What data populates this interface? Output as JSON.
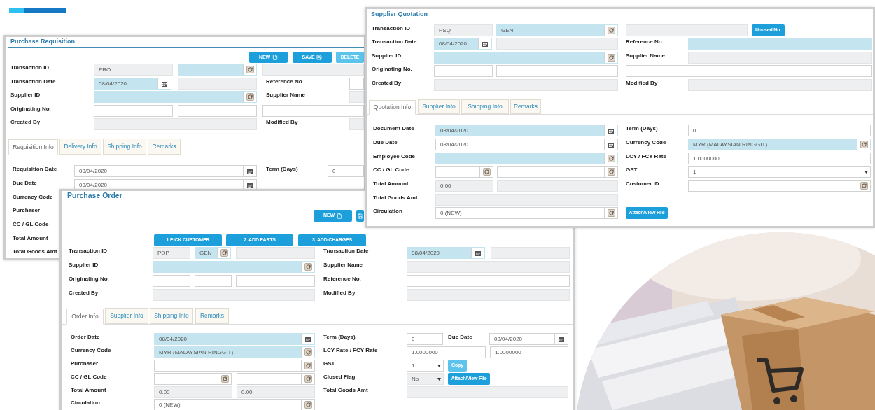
{
  "purchase_requisition": {
    "title": "Purchase Requisition",
    "toolbar": [
      {
        "label": "NEW",
        "disabled": false
      },
      {
        "label": "SAVE",
        "disabled": false
      },
      {
        "label": "DELETE",
        "disabled": true
      }
    ],
    "header": [
      [
        {
          "kind": "label",
          "text": "Transaction ID"
        },
        {
          "kind": "text_field",
          "required": false,
          "readonly": true,
          "value": "PRO"
        },
        {
          "kind": "lookup_field",
          "required": true,
          "readonly": false
        },
        {
          "kind": "text_field",
          "required": false,
          "readonly": true
        }
      ],
      [
        {
          "kind": "label",
          "text": "Transaction Date"
        },
        {
          "kind": "date_field",
          "required": true,
          "readonly": false,
          "value": "08/04/2020"
        },
        {
          "kind": "text_field",
          "required": false,
          "readonly": true
        },
        {
          "kind": "label",
          "text": "Reference No."
        },
        {
          "kind": "text_field",
          "required": false,
          "readonly": false
        }
      ],
      [
        {
          "kind": "label",
          "text": "Supplier ID"
        },
        {
          "kind": "lookup_field",
          "required": true,
          "readonly": false
        },
        {
          "kind": "label",
          "text": "Supplier Name"
        },
        {
          "kind": "text_field",
          "required": false,
          "readonly": true
        }
      ],
      [
        {
          "kind": "label",
          "text": "Originating No."
        },
        {
          "kind": "text_field",
          "required": false,
          "readonly": false
        },
        {
          "kind": "text_field",
          "required": false,
          "readonly": false
        },
        {
          "kind": "text_field",
          "required": false,
          "readonly": false
        }
      ],
      [
        {
          "kind": "label",
          "text": "Created By"
        },
        {
          "kind": "text_field",
          "required": false,
          "readonly": true
        },
        {
          "kind": "label",
          "text": "Modified By"
        },
        {
          "kind": "text_field",
          "required": false,
          "readonly": true
        }
      ]
    ],
    "tabs": [
      {
        "label": "Requisition Info",
        "selected": true
      },
      {
        "label": "Delivery Info",
        "selected": false
      },
      {
        "label": "Shipping Info",
        "selected": false
      },
      {
        "label": "Remarks",
        "selected": false
      }
    ],
    "body": [
      [
        {
          "kind": "label",
          "text": "Requisition Date"
        },
        {
          "kind": "date_field",
          "required": false,
          "readonly": false,
          "value": "08/04/2020"
        },
        {
          "kind": "label",
          "text": "Term (Days)"
        },
        {
          "kind": "text_field",
          "required": false,
          "readonly": false,
          "value": "0"
        }
      ],
      [
        {
          "kind": "label",
          "text": "Due Date"
        },
        {
          "kind": "date_field",
          "required": false,
          "readonly": false,
          "value": "08/04/2020"
        }
      ],
      [
        {
          "kind": "label",
          "text": "Currency Code"
        }
      ],
      [
        {
          "kind": "label",
          "text": "Purchaser"
        }
      ],
      [
        {
          "kind": "label",
          "text": "CC / GL Code"
        }
      ],
      [
        {
          "kind": "label",
          "text": "Total Amount"
        }
      ],
      [
        {
          "kind": "label",
          "text": "Total Goods Amt"
        }
      ]
    ]
  },
  "supplier_quotation": {
    "title": "Supplier Quotation",
    "header": [
      [
        {
          "kind": "label",
          "text": "Transaction ID"
        },
        {
          "kind": "text_field",
          "required": false,
          "readonly": true,
          "value": "PSQ"
        },
        {
          "kind": "lookup_field",
          "required": true,
          "readonly": false,
          "value": "GEN"
        },
        {
          "kind": "text_field",
          "required": false,
          "readonly": true
        },
        {
          "kind": "button",
          "label": "Unused No.",
          "disabled": false
        }
      ],
      [
        {
          "kind": "label",
          "text": "Transaction Date"
        },
        {
          "kind": "date_field",
          "required": true,
          "readonly": false,
          "value": "08/04/2020"
        },
        {
          "kind": "text_field",
          "required": false,
          "readonly": true
        },
        {
          "kind": "label",
          "text": "Reference No."
        },
        {
          "kind": "text_field",
          "required": true,
          "readonly": false
        }
      ],
      [
        {
          "kind": "label",
          "text": "Supplier ID"
        },
        {
          "kind": "lookup_field",
          "required": true,
          "readonly": false
        },
        {
          "kind": "label",
          "text": "Supplier Name"
        },
        {
          "kind": "text_field",
          "required": false,
          "readonly": true
        }
      ],
      [
        {
          "kind": "label",
          "text": "Originating No."
        },
        {
          "kind": "text_field",
          "required": false,
          "readonly": false
        },
        {
          "kind": "text_field",
          "required": false,
          "readonly": false
        },
        {
          "kind": "text_field",
          "required": false,
          "readonly": false
        }
      ],
      [
        {
          "kind": "label",
          "text": "Created By"
        },
        {
          "kind": "text_field",
          "required": false,
          "readonly": true
        },
        {
          "kind": "label",
          "text": "Modified By"
        },
        {
          "kind": "text_field",
          "required": false,
          "readonly": true
        }
      ]
    ],
    "tabs": [
      {
        "label": "Quotation Info",
        "selected": true
      },
      {
        "label": "Supplier Info",
        "selected": false
      },
      {
        "label": "Shipping Info",
        "selected": false
      },
      {
        "label": "Remarks",
        "selected": false
      }
    ],
    "body": [
      [
        {
          "kind": "label",
          "text": "Document Date"
        },
        {
          "kind": "date_field",
          "required": true,
          "readonly": false,
          "value": "08/04/2020"
        },
        {
          "kind": "label",
          "text": "Term (Days)"
        },
        {
          "kind": "text_field",
          "required": false,
          "readonly": false,
          "value": "0"
        }
      ],
      [
        {
          "kind": "label",
          "text": "Due Date"
        },
        {
          "kind": "date_field",
          "required": false,
          "readonly": false,
          "value": "08/04/2020"
        },
        {
          "kind": "label",
          "text": "Currency Code"
        },
        {
          "kind": "lookup_field",
          "required": true,
          "readonly": false,
          "value": "MYR (MALAYSIAN RINGGIT)"
        }
      ],
      [
        {
          "kind": "label",
          "text": "Employee Code"
        },
        {
          "kind": "lookup_field",
          "required": true,
          "readonly": false
        },
        {
          "kind": "label",
          "text": "LCY / FCY Rate"
        },
        {
          "kind": "text_field",
          "required": false,
          "readonly": false,
          "value": "1.0000000"
        }
      ],
      [
        {
          "kind": "label",
          "text": "CC / GL Code"
        },
        {
          "kind": "lookup_field",
          "required": false,
          "readonly": false
        },
        {
          "kind": "lookup_field",
          "required": false,
          "readonly": false
        },
        {
          "kind": "label",
          "text": "GST"
        },
        {
          "kind": "select_field",
          "required": false,
          "readonly": false,
          "value": "1"
        }
      ],
      [
        {
          "kind": "label",
          "text": "Total Amount"
        },
        {
          "kind": "text_field",
          "required": false,
          "readonly": true,
          "value": "0.00"
        },
        {
          "kind": "text_field",
          "required": false,
          "readonly": true
        },
        {
          "kind": "label",
          "text": "Customer ID"
        },
        {
          "kind": "lookup_field",
          "required": false,
          "readonly": false
        }
      ],
      [
        {
          "kind": "label",
          "text": "Total Goods Amt"
        },
        {
          "kind": "text_field",
          "required": false,
          "readonly": true
        }
      ],
      [
        {
          "kind": "label",
          "text": "Circulation"
        },
        {
          "kind": "lookup_field",
          "required": false,
          "readonly": false,
          "value": "0 (NEW)"
        },
        {
          "kind": "button",
          "label": "Attach/View File",
          "disabled": false
        }
      ]
    ]
  },
  "purchase_order": {
    "title": "Purchase Order",
    "toolbar": [
      {
        "label": "NEW",
        "disabled": false
      },
      {
        "disabled": false
      }
    ],
    "steps": [
      {
        "label": "1.PICK CUSTOMER",
        "disabled": false
      },
      {
        "label": "2. ADD PARTS",
        "disabled": false
      },
      {
        "label": "3. ADD CHARGES",
        "disabled": false
      }
    ],
    "header": [
      [
        {
          "kind": "label",
          "text": "Transaction ID"
        },
        {
          "kind": "text_field",
          "required": false,
          "readonly": true,
          "value": "POP"
        },
        {
          "kind": "lookup_field",
          "required": true,
          "readonly": false,
          "value": "GEN"
        },
        {
          "kind": "text_field",
          "required": false,
          "readonly": true
        },
        {
          "kind": "label",
          "text": "Transaction Date"
        },
        {
          "kind": "date_field",
          "required": true,
          "readonly": false,
          "value": "08/04/2020"
        },
        {
          "kind": "text_field",
          "required": false,
          "readonly": true
        }
      ],
      [
        {
          "kind": "label",
          "text": "Supplier ID"
        },
        {
          "kind": "lookup_field",
          "required": true,
          "readonly": false
        },
        {
          "kind": "label",
          "text": "Supplier Name"
        },
        {
          "kind": "text_field",
          "required": false,
          "readonly": true
        }
      ],
      [
        {
          "kind": "label",
          "text": "Originating No."
        },
        {
          "kind": "text_field",
          "required": false,
          "readonly": false
        },
        {
          "kind": "text_field",
          "required": false,
          "readonly": false
        },
        {
          "kind": "text_field",
          "required": false,
          "readonly": false
        },
        {
          "kind": "label",
          "text": "Reference No."
        },
        {
          "kind": "text_field",
          "required": false,
          "readonly": false
        }
      ],
      [
        {
          "kind": "label",
          "text": "Created By"
        },
        {
          "kind": "text_field",
          "required": false,
          "readonly": true
        },
        {
          "kind": "label",
          "text": "Modified By"
        },
        {
          "kind": "text_field",
          "required": false,
          "readonly": true
        }
      ]
    ],
    "tabs": [
      {
        "label": "Order Info",
        "selected": true
      },
      {
        "label": "Supplier Info",
        "selected": false
      },
      {
        "label": "Shipping Info",
        "selected": false
      },
      {
        "label": "Remarks",
        "selected": false
      }
    ],
    "body": [
      [
        {
          "kind": "label",
          "text": "Order Date"
        },
        {
          "kind": "date_field",
          "required": true,
          "readonly": false,
          "value": "08/04/2020"
        },
        {
          "kind": "label",
          "text": "Term (Days)"
        },
        {
          "kind": "text_field",
          "required": false,
          "readonly": false,
          "value": "0"
        },
        {
          "kind": "label",
          "text": "Due Date"
        },
        {
          "kind": "date_field",
          "required": false,
          "readonly": false,
          "value": "08/04/2020"
        }
      ],
      [
        {
          "kind": "label",
          "text": "Currency Code"
        },
        {
          "kind": "lookup_field",
          "required": true,
          "readonly": false,
          "value": "MYR (MALAYSIAN RINGGIT)"
        },
        {
          "kind": "label",
          "text": "LCY Rate / FCY Rate"
        },
        {
          "kind": "text_field",
          "required": false,
          "readonly": false,
          "value": "1.0000000"
        },
        {
          "kind": "text_field",
          "required": false,
          "readonly": false,
          "value": "1.0000000"
        }
      ],
      [
        {
          "kind": "label",
          "text": "Purchaser"
        },
        {
          "kind": "lookup_field",
          "required": false,
          "readonly": false
        },
        {
          "kind": "label",
          "text": "GST"
        },
        {
          "kind": "select_field",
          "required": false,
          "readonly": false,
          "value": "1"
        },
        {
          "kind": "button",
          "label": "Copy",
          "disabled": true
        }
      ],
      [
        {
          "kind": "label",
          "text": "CC / GL Code"
        },
        {
          "kind": "lookup_field",
          "required": false,
          "readonly": false
        },
        {
          "kind": "lookup_field",
          "required": false,
          "readonly": false
        },
        {
          "kind": "label",
          "text": "Closed Flag"
        },
        {
          "kind": "select_field",
          "required": false,
          "readonly": true,
          "value": "No"
        },
        {
          "kind": "button",
          "label": "Attach/View File",
          "disabled": false
        }
      ],
      [
        {
          "kind": "label",
          "text": "Total Amount"
        },
        {
          "kind": "text_field",
          "required": false,
          "readonly": true,
          "value": "0.00"
        },
        {
          "kind": "text_field",
          "required": false,
          "readonly": true,
          "value": "0.00"
        },
        {
          "kind": "label",
          "text": "Total Goods Amt"
        },
        {
          "kind": "text_field",
          "required": false,
          "readonly": true
        }
      ],
      [
        {
          "kind": "label",
          "text": "Circulation"
        },
        {
          "kind": "lookup_field",
          "required": false,
          "readonly": false,
          "value": "0 (NEW)"
        }
      ]
    ]
  }
}
